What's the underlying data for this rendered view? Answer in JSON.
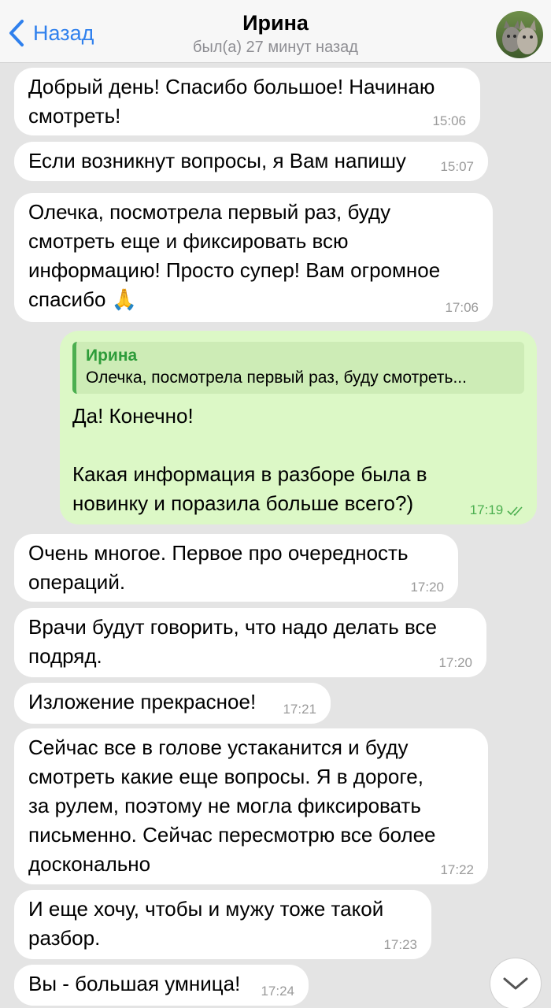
{
  "header": {
    "back_label": "Назад",
    "contact_name": "Ирина",
    "last_seen": "был(а) 27 минут назад"
  },
  "colors": {
    "accent": "#2f80ed",
    "incoming_bubble": "#ffffff",
    "outgoing_bubble": "#dcf8c6",
    "chat_background": "#e4e4e4"
  },
  "messages": [
    {
      "lines": [
        "Добрый день! Спасибо большое! Начинаю",
        "смотреть!"
      ],
      "time": "15:06"
    },
    {
      "lines": [
        "Если возникнут вопросы, я Вам напишу"
      ],
      "time": "15:07"
    },
    {
      "lines": [
        "Олечка, посмотрела первый раз, буду",
        "смотреть еще и фиксировать всю",
        "информацию! Просто супер! Вам огромное",
        "спасибо 🙏"
      ],
      "time": "17:06"
    },
    {
      "reply_name": "Ирина",
      "reply_text": "Олечка, посмотрела первый раз, буду смотреть...",
      "lines": [
        "Да! Конечно!",
        "",
        "Какая информация в разборе была в",
        "новинку и поразила больше всего?)"
      ],
      "time": "17:19",
      "status_icon": "double-check-icon"
    },
    {
      "lines": [
        "Очень многое. Первое про очередность",
        "операций."
      ],
      "time": "17:20"
    },
    {
      "lines": [
        "Врачи будут говорить, что надо делать все",
        "подряд."
      ],
      "time": "17:20"
    },
    {
      "lines": [
        "Изложение прекрасное!"
      ],
      "time": "17:21"
    },
    {
      "lines": [
        "Сейчас все в голове устаканится и буду",
        "смотреть какие еще вопросы. Я в дороге,",
        "за рулем, поэтому не могла фиксировать",
        "письменно. Сейчас пересмотрю все более",
        "досконально"
      ],
      "time": "17:22"
    },
    {
      "lines": [
        "И еще хочу, чтобы и мужу тоже такой",
        "разбор."
      ],
      "time": "17:23"
    },
    {
      "lines": [
        "Вы - большая умница!"
      ],
      "time": "17:24"
    }
  ],
  "scroll_button_icon": "chevron-down-icon"
}
